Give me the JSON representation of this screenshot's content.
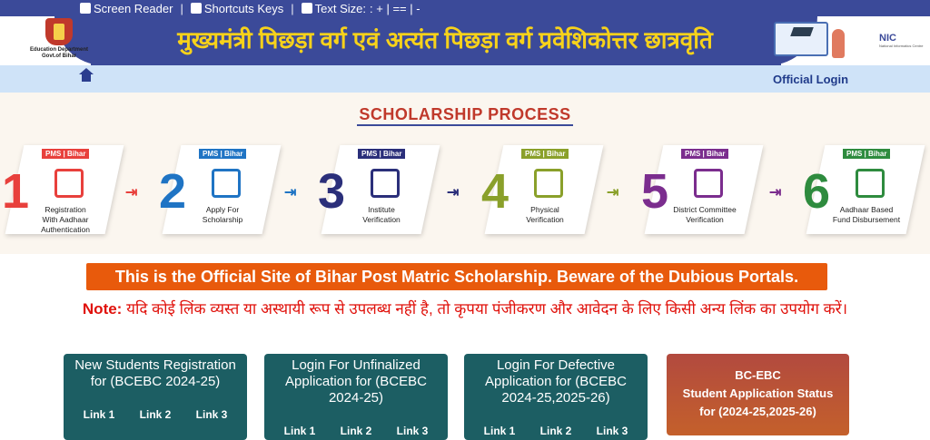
{
  "topbar": {
    "screen_reader": "Screen Reader",
    "shortcut_keys": "Shortcuts Keys",
    "text_size": "Text Size:",
    "size_controls": ": + | == | -"
  },
  "header": {
    "logo_line1": "Education Department",
    "logo_line2": "Govt.of Bihar",
    "title": "मुख्यमंत्री पिछड़ा वर्ग एवं अत्यंत पिछड़ा वर्ग प्रवेशिकोत्तर छात्रवृति",
    "nic": "NIC",
    "nic_sub": "National Informatics Centre"
  },
  "nav": {
    "official_login": "Official Login"
  },
  "process": {
    "title": "SCHOLARSHIP PROCESS",
    "steps": [
      {
        "num": "1",
        "tag": "PMS | Bihar",
        "line1": "Registration",
        "line2": "With Aadhaar",
        "line3": "Authentication",
        "color": "#e8403c",
        "icon": "fingerprint-icon"
      },
      {
        "num": "2",
        "tag": "PMS | Bihar",
        "line1": "Apply For",
        "line2": "Scholarship",
        "line3": "",
        "color": "#1f74c4",
        "icon": "form-icon"
      },
      {
        "num": "3",
        "tag": "PMS | Bihar",
        "line1": "Institute",
        "line2": "Verification",
        "line3": "",
        "color": "#2b2f7a",
        "icon": "building-icon"
      },
      {
        "num": "4",
        "tag": "PMS | Bihar",
        "line1": "Physical",
        "line2": "Verification",
        "line3": "",
        "color": "#8aa02a",
        "icon": "checklist-icon"
      },
      {
        "num": "5",
        "tag": "PMS | Bihar",
        "line1": "District Committee",
        "line2": "Verification",
        "line3": "",
        "color": "#7b2d8e",
        "icon": "committee-icon"
      },
      {
        "num": "6",
        "tag": "PMS | Bihar",
        "line1": "Aadhaar Based",
        "line2": "Fund Disbursement",
        "line3": "",
        "color": "#2e8b3e",
        "icon": "rupee-icon"
      }
    ]
  },
  "notice": "This is the Official Site of Bihar Post Matric Scholarship. Beware of the Dubious Portals.",
  "note": {
    "label": "Note:",
    "text": " यदि कोई लिंक व्यस्त या अस्थायी रूप से उपलब्ध नहीं है, तो कृपया पंजीकरण और आवेदन के लिए किसी अन्य लिंक का उपयोग करें।"
  },
  "cards": [
    {
      "title": "New Students Registration for (BCEBC 2024-25)",
      "links": [
        "Link 1",
        "Link 2",
        "Link 3"
      ]
    },
    {
      "title": "Login For Unfinalized Application for (BCEBC 2024-25)",
      "links": [
        "Link 1",
        "Link 2",
        "Link 3"
      ]
    },
    {
      "title": "Login For Defective Application for (BCEBC 2024-25,2025-26)",
      "links": [
        "Link 1",
        "Link 2",
        "Link 3"
      ]
    },
    {
      "line1": "BC-EBC",
      "line2": "Student Application Status",
      "line3": "for (2024-25,2025-26)"
    }
  ]
}
